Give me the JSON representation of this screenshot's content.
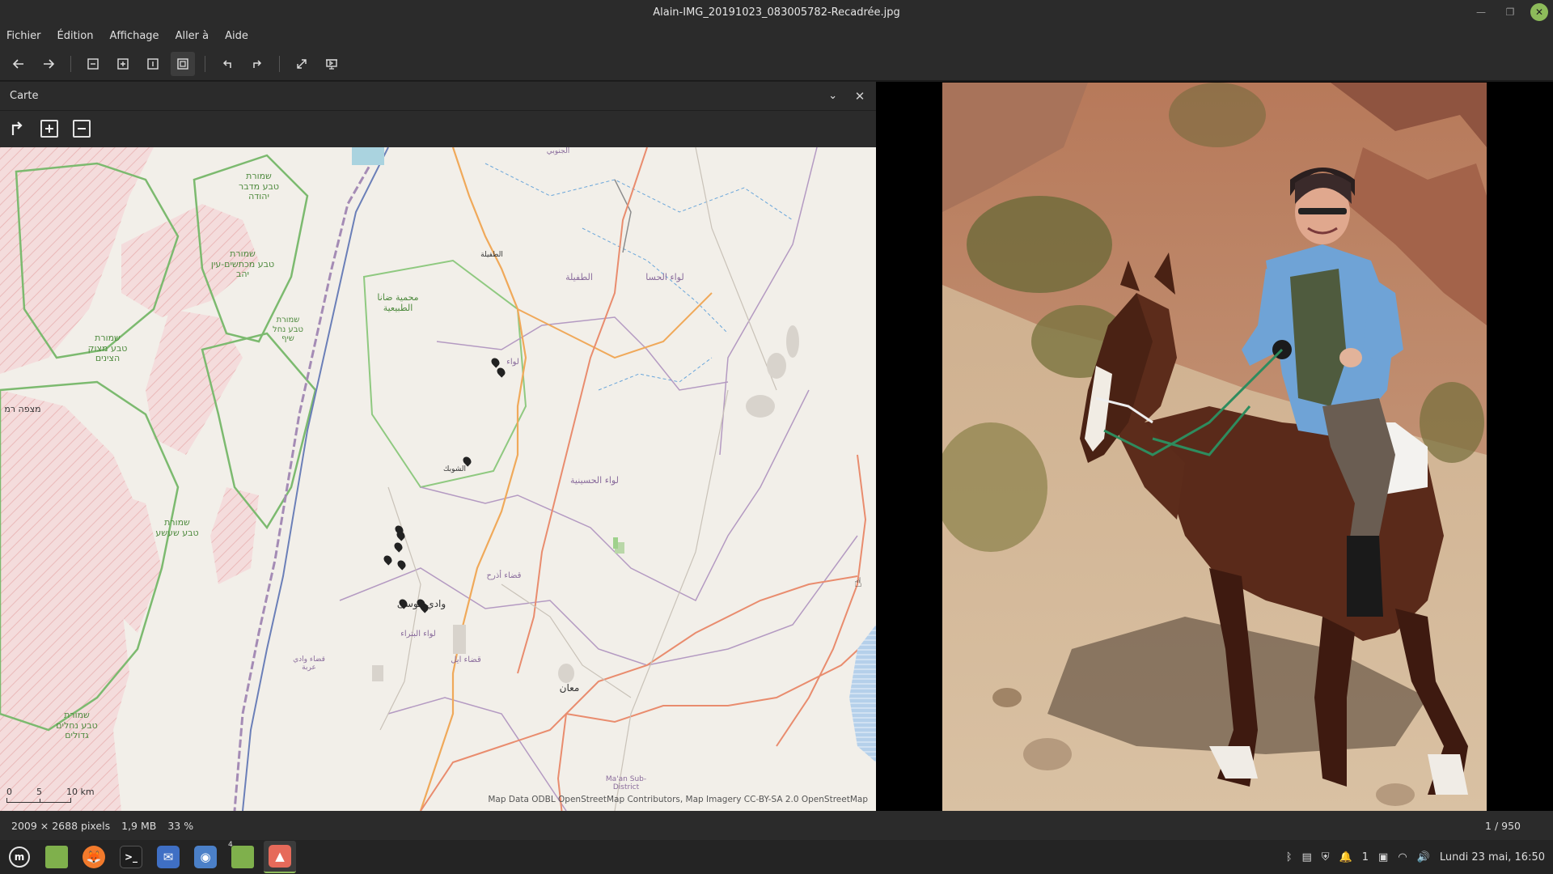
{
  "window": {
    "title": "Alain-IMG_20191023_083005782-Recadrée.jpg"
  },
  "menu": [
    "Fichier",
    "Édition",
    "Affichage",
    "Aller à",
    "Aide"
  ],
  "panel": {
    "title": "Carte",
    "close_glyph": "✕",
    "dropdown_glyph": "⌄"
  },
  "map": {
    "labels": {
      "shmurat_midbar_yehuda": "שמורת\nטבע מדבר\nיהודה",
      "shmurat_machtesh": "שמורת\nטבע מכתשים-עין\nיהב",
      "shmurat_nahal_shaif": "שמורת\nטבע נחל\nשיף",
      "shmurat_metzok": "שמורת\nטבע מצוק\nהצינים",
      "mitzpe_ramon": "מצפה רמ",
      "shmurat_shizaf": "שמורת\nטבע שעשע",
      "shmurat_nehalim": "שמורת\nטבע נחלים\nגדולים",
      "dana": "محمية ضانا\nالطبيعية",
      "tafila_town": "الطفيلة",
      "tafila_district": "الطفيلة",
      "hasa": "لواء الحسا",
      "liwa_top": "لواء",
      "shobak": "الشوبك",
      "husseiniya": "لواء الحسينية",
      "adhruh": "قضاء أذرح",
      "wadi_musa": "وادي موسى",
      "petra": "لواء البتراء",
      "ail": "قضاء ايل",
      "wadi_araba": "قضاء وادي\nعربة",
      "maan": "معان",
      "maan_sub": "Ma'an Sub-\nDistrict",
      "south": "الجنوبي"
    },
    "scale": {
      "zero": "0",
      "five": "5",
      "ten": "10 km"
    },
    "attribution": "Map Data ODBL OpenStreetMap Contributors, Map Imagery CC-BY-SA 2.0 OpenStreetMap"
  },
  "status": {
    "dimensions": "2009 × 2688 pixels",
    "size": "1,9 MB",
    "zoom": "33 %",
    "counter": "1 / 950"
  },
  "taskbar": {
    "workspace_badge": "4",
    "notification_count": "1",
    "clock": "Lundi 23 mai, 16:50"
  }
}
